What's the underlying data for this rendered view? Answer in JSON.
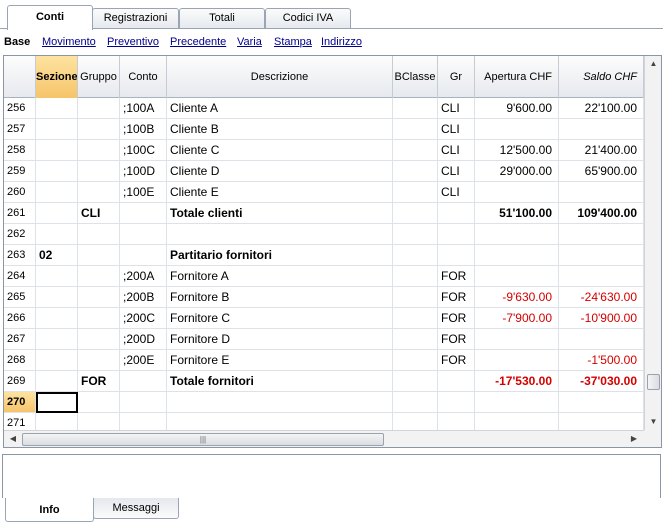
{
  "top_tabs": [
    "Conti",
    "Registrazioni",
    "Totali",
    "Codici IVA"
  ],
  "views": [
    "Base",
    "Movimento",
    "Preventivo",
    "Precedente",
    "Varia",
    "Stampa",
    "Indirizzo"
  ],
  "columns": [
    "Sezione",
    "Gruppo",
    "Conto",
    "Descrizione",
    "BClasse",
    "Gr",
    "Apertura CHF",
    "Saldo CHF"
  ],
  "rows": [
    {
      "n": "256",
      "sez": "",
      "gruppo": "",
      "conto": ";100A",
      "desc": "Cliente A",
      "bclasse": "",
      "gr": "CLI",
      "apertura": "9'600.00",
      "saldo": "22'100.00",
      "bold": false,
      "neg": false
    },
    {
      "n": "257",
      "sez": "",
      "gruppo": "",
      "conto": ";100B",
      "desc": "Cliente B",
      "bclasse": "",
      "gr": "CLI",
      "apertura": "",
      "saldo": "",
      "bold": false,
      "neg": false
    },
    {
      "n": "258",
      "sez": "",
      "gruppo": "",
      "conto": ";100C",
      "desc": "Cliente C",
      "bclasse": "",
      "gr": "CLI",
      "apertura": "12'500.00",
      "saldo": "21'400.00",
      "bold": false,
      "neg": false
    },
    {
      "n": "259",
      "sez": "",
      "gruppo": "",
      "conto": ";100D",
      "desc": "Cliente D",
      "bclasse": "",
      "gr": "CLI",
      "apertura": "29'000.00",
      "saldo": "65'900.00",
      "bold": false,
      "neg": false
    },
    {
      "n": "260",
      "sez": "",
      "gruppo": "",
      "conto": ";100E",
      "desc": "Cliente E",
      "bclasse": "",
      "gr": "CLI",
      "apertura": "",
      "saldo": "",
      "bold": false,
      "neg": false
    },
    {
      "n": "261",
      "sez": "",
      "gruppo": "CLI",
      "conto": "",
      "desc": "Totale clienti",
      "bclasse": "",
      "gr": "",
      "apertura": "51'100.00",
      "saldo": "109'400.00",
      "bold": true,
      "neg": false
    },
    {
      "n": "262",
      "sez": "",
      "gruppo": "",
      "conto": "",
      "desc": "",
      "bclasse": "",
      "gr": "",
      "apertura": "",
      "saldo": "",
      "bold": false,
      "neg": false
    },
    {
      "n": "263",
      "sez": "02",
      "gruppo": "",
      "conto": "",
      "desc": "Partitario fornitori",
      "bclasse": "",
      "gr": "",
      "apertura": "",
      "saldo": "",
      "bold": true,
      "neg": false
    },
    {
      "n": "264",
      "sez": "",
      "gruppo": "",
      "conto": ";200A",
      "desc": "Fornitore A",
      "bclasse": "",
      "gr": "FOR",
      "apertura": "",
      "saldo": "",
      "bold": false,
      "neg": false
    },
    {
      "n": "265",
      "sez": "",
      "gruppo": "",
      "conto": ";200B",
      "desc": "Fornitore B",
      "bclasse": "",
      "gr": "FOR",
      "apertura": "-9'630.00",
      "saldo": "-24'630.00",
      "bold": false,
      "neg": true
    },
    {
      "n": "266",
      "sez": "",
      "gruppo": "",
      "conto": ";200C",
      "desc": "Fornitore C",
      "bclasse": "",
      "gr": "FOR",
      "apertura": "-7'900.00",
      "saldo": "-10'900.00",
      "bold": false,
      "neg": true
    },
    {
      "n": "267",
      "sez": "",
      "gruppo": "",
      "conto": ";200D",
      "desc": "Fornitore D",
      "bclasse": "",
      "gr": "FOR",
      "apertura": "",
      "saldo": "",
      "bold": false,
      "neg": false
    },
    {
      "n": "268",
      "sez": "",
      "gruppo": "",
      "conto": ";200E",
      "desc": "Fornitore E",
      "bclasse": "",
      "gr": "FOR",
      "apertura": "",
      "saldo": "-1'500.00",
      "bold": false,
      "neg": true
    },
    {
      "n": "269",
      "sez": "",
      "gruppo": "FOR",
      "conto": "",
      "desc": "Totale fornitori",
      "bclasse": "",
      "gr": "",
      "apertura": "-17'530.00",
      "saldo": "-37'030.00",
      "bold": true,
      "neg": true
    },
    {
      "n": "270",
      "sez": "",
      "gruppo": "",
      "conto": "",
      "desc": "",
      "bclasse": "",
      "gr": "",
      "apertura": "",
      "saldo": "",
      "bold": false,
      "neg": false,
      "current": true
    },
    {
      "n": "271",
      "sez": "",
      "gruppo": "",
      "conto": "",
      "desc": "",
      "bclasse": "",
      "gr": "",
      "apertura": "",
      "saldo": "",
      "bold": false,
      "neg": false
    }
  ],
  "scrollbar": {
    "vertical_position": 0.85,
    "horizontal_thumb_label": "|||"
  },
  "bottom_tabs": [
    "Info",
    "Messaggi"
  ],
  "colors": {
    "negative": "#d40000",
    "selected_header": "#f6c46a",
    "link": "#00008b"
  }
}
